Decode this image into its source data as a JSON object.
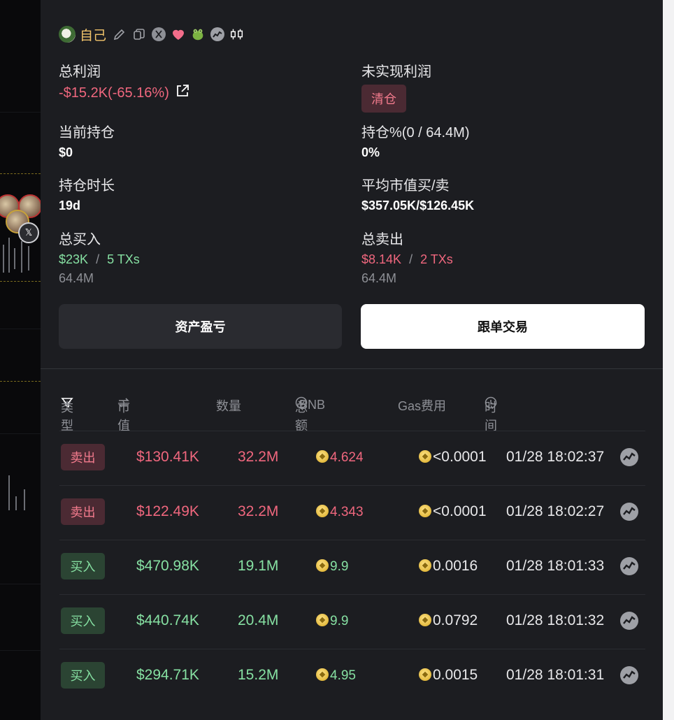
{
  "profile": {
    "name": "自己"
  },
  "stats": {
    "total_profit_label": "总利润",
    "total_profit_value": "-$15.2K(-65.16%)",
    "unrealized_label": "未实现利润",
    "clear_label": "清仓",
    "holding_label": "当前持仓",
    "holding_value": "$0",
    "holding_pct_label": "持仓%(0 / 64.4M)",
    "holding_pct_value": "0%",
    "duration_label": "持仓时长",
    "duration_value": "19d",
    "avg_mcap_label": "平均市值买/卖",
    "avg_mcap_value": "$357.05K/$126.45K",
    "total_buy_label": "总买入",
    "total_buy_amount": "$23K",
    "total_buy_sep": "/",
    "total_buy_txs": "5 TXs",
    "total_buy_qty": "64.4M",
    "total_sell_label": "总卖出",
    "total_sell_amount": "$8.14K",
    "total_sell_sep": "/",
    "total_sell_txs": "2 TXs",
    "total_sell_qty": "64.4M"
  },
  "buttons": {
    "pnl": "资产盈亏",
    "copy_trade": "跟单交易"
  },
  "table": {
    "headers": {
      "type": "类型",
      "mcap": "市值",
      "qty": "数量",
      "total": "总额",
      "total_unit": "BNB",
      "gas": "Gas费用",
      "time": "时间"
    },
    "rows": [
      {
        "type": "卖出",
        "side": "sell",
        "mcap": "$130.41K",
        "qty": "32.2M",
        "total": "4.624",
        "gas": "<0.0001",
        "time": "01/28 18:02:37"
      },
      {
        "type": "卖出",
        "side": "sell",
        "mcap": "$122.49K",
        "qty": "32.2M",
        "total": "4.343",
        "gas": "<0.0001",
        "time": "01/28 18:02:27"
      },
      {
        "type": "买入",
        "side": "buy",
        "mcap": "$470.98K",
        "qty": "19.1M",
        "total": "9.9",
        "gas": "0.0016",
        "time": "01/28 18:01:33"
      },
      {
        "type": "买入",
        "side": "buy",
        "mcap": "$440.74K",
        "qty": "20.4M",
        "total": "9.9",
        "gas": "0.0792",
        "time": "01/28 18:01:32"
      },
      {
        "type": "买入",
        "side": "buy",
        "mcap": "$294.71K",
        "qty": "15.2M",
        "total": "4.95",
        "gas": "0.0015",
        "time": "01/28 18:01:31"
      }
    ]
  },
  "colors": {
    "sell": "#f0677e",
    "buy": "#86e0a2",
    "name": "#f0c36a",
    "panel_bg": "#1c1d21"
  }
}
